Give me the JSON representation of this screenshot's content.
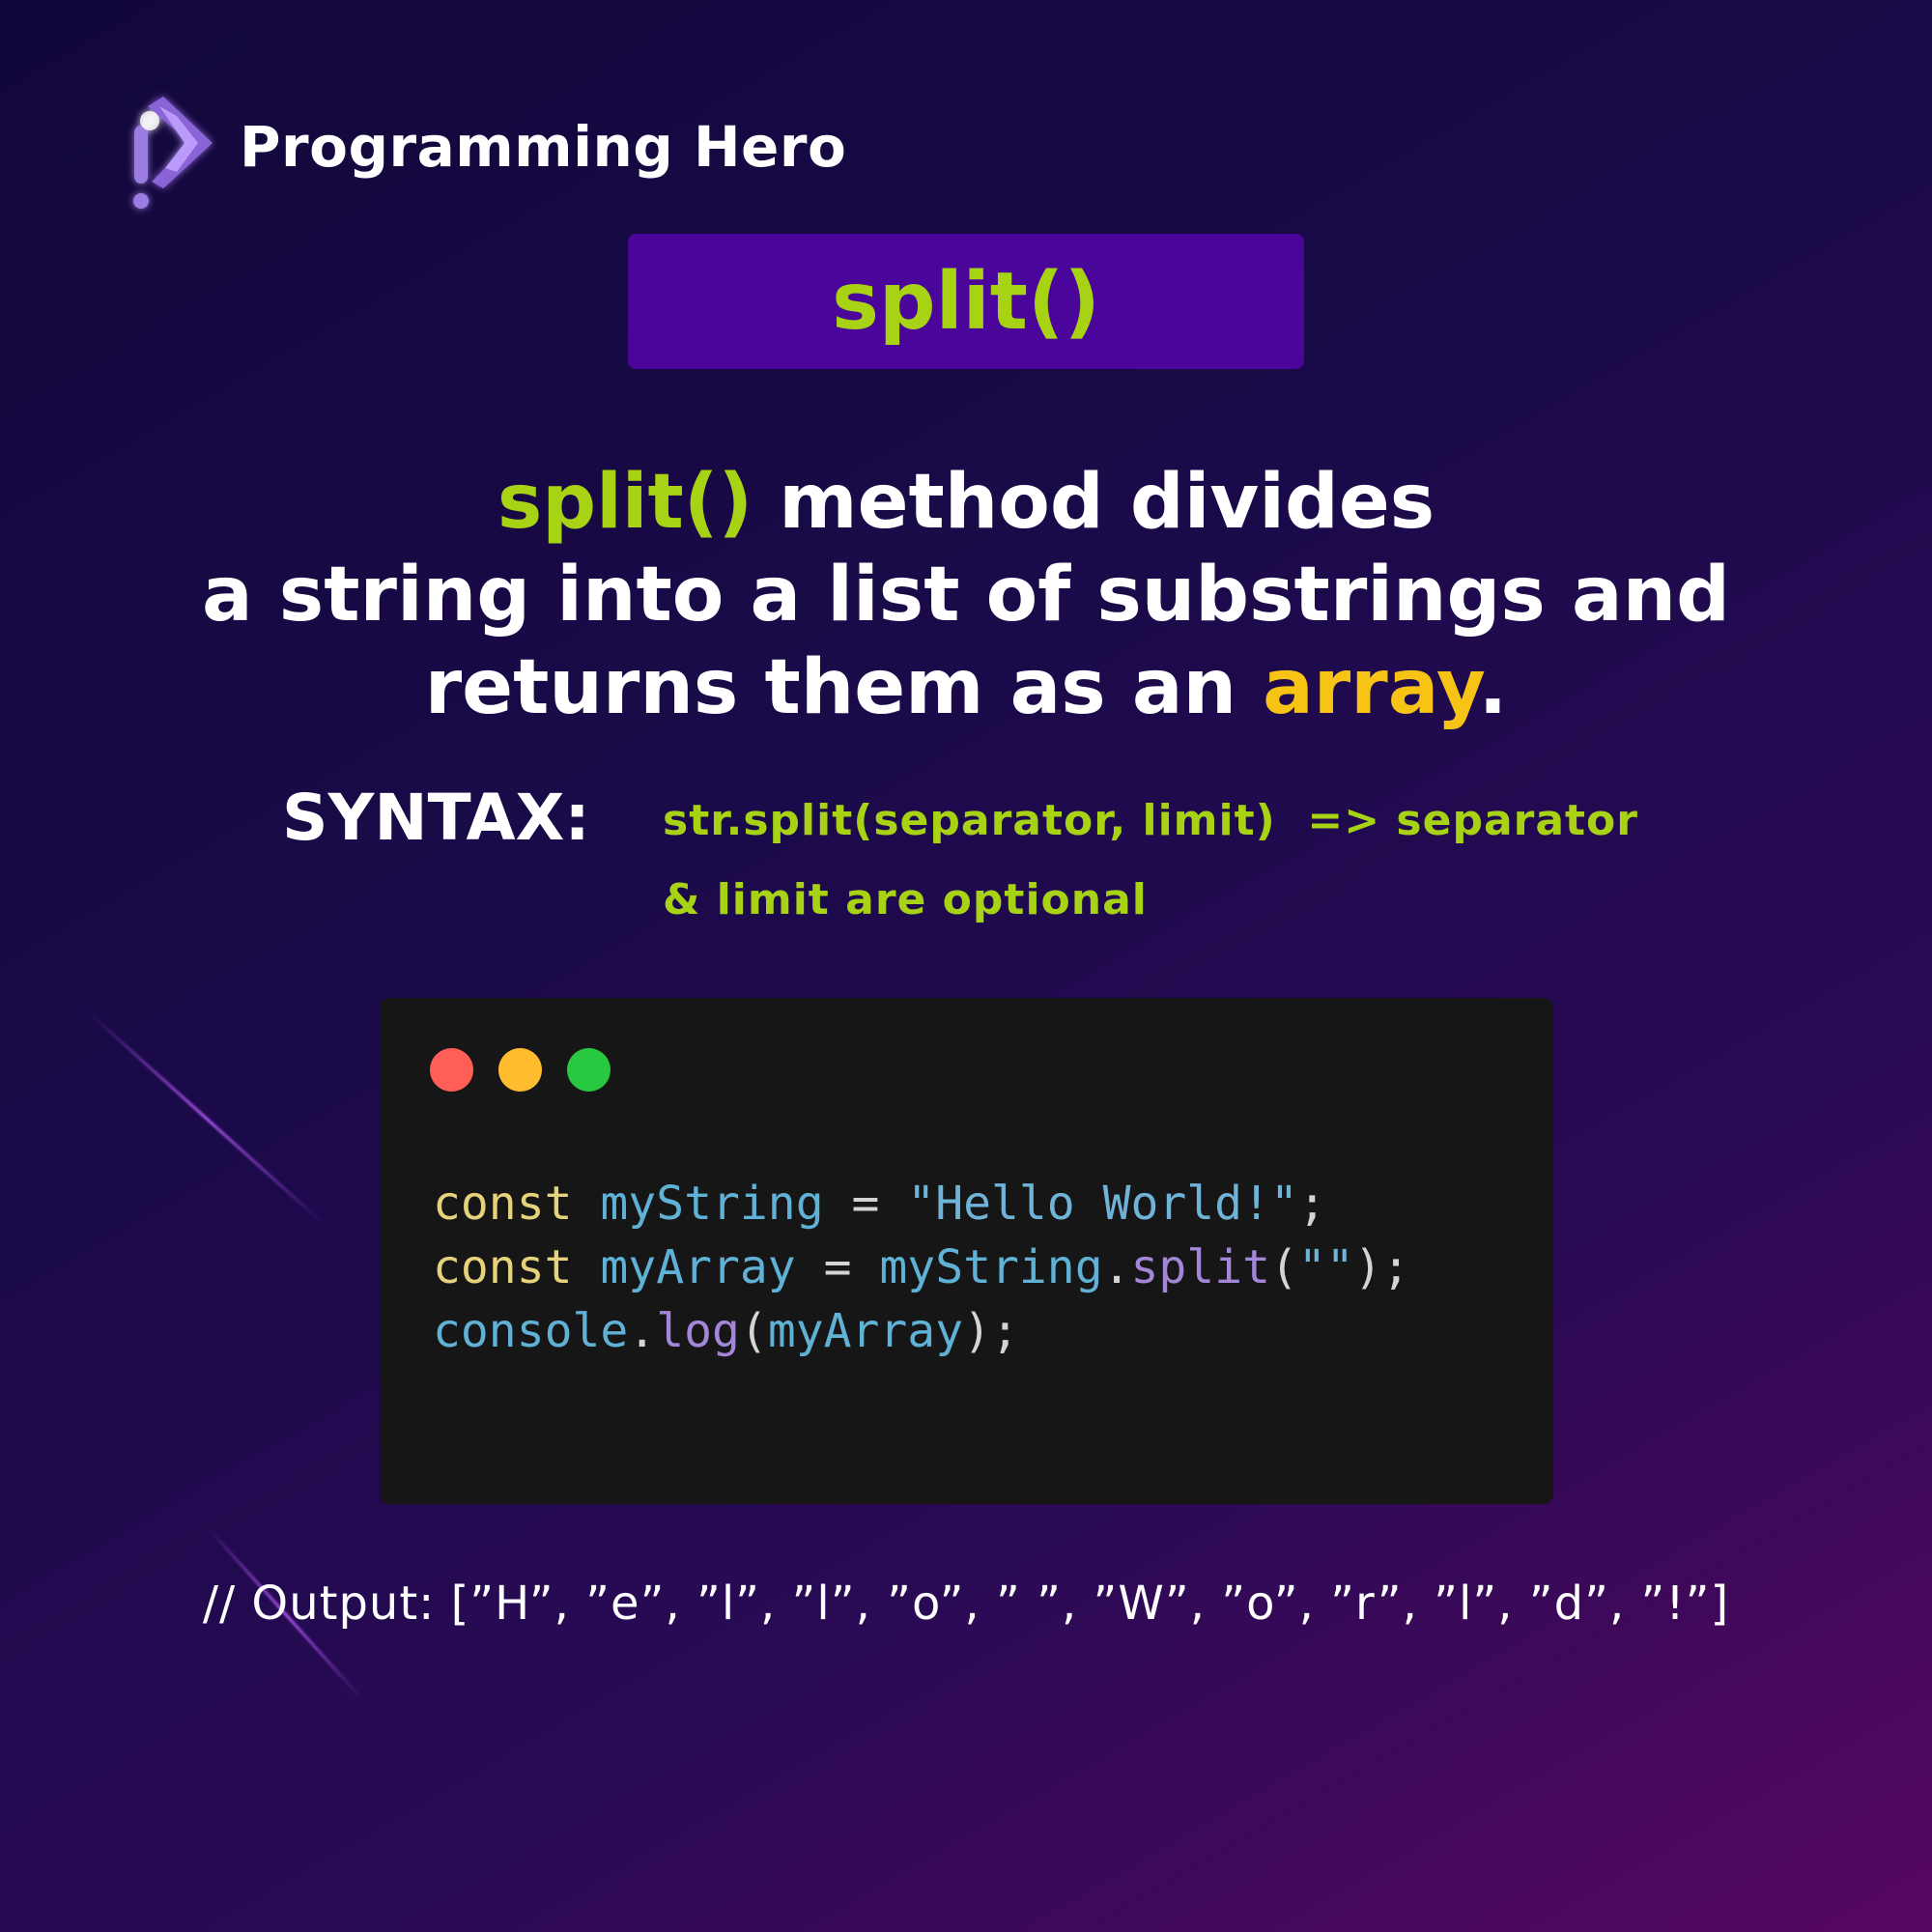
{
  "brand": {
    "name": "Programming Hero",
    "logo_icon": "programming-hero-logo-icon"
  },
  "title": "split()",
  "description": {
    "line1_method": "split()",
    "line1_rest": " method divides",
    "line2": "a string into a list of substrings and",
    "line3_pre": "returns them as an ",
    "line3_highlight": "array",
    "line3_post": "."
  },
  "syntax": {
    "label": "SYNTAX:",
    "line1": "str.split(separator, limit)  => separator",
    "line2": "& limit are optional"
  },
  "code_window": {
    "dots": [
      "#ff5f57",
      "#febc2e",
      "#28c840"
    ],
    "line1": {
      "kw": "const",
      "var": "myString",
      "eq": " = ",
      "str": "\"Hello World!\"",
      "end": ";"
    },
    "line2": {
      "kw": "const",
      "var": "myArray",
      "eq": " = ",
      "obj": "myString",
      "dot": ".",
      "fn": "split",
      "open": "(",
      "str": "\"\"",
      "close": ");"
    },
    "line3": {
      "obj": "console",
      "dot": ".",
      "fn": "log",
      "open": "(",
      "arg": "myArray",
      "close": ");"
    }
  },
  "output": "// Output: [”H”, ”e”, ”l”, ”l”, ”o”, ” ”, ”W”, ”o”, ”r”, ”l”, ”d”, ”!”]",
  "colors": {
    "accent_green": "#a8d214",
    "accent_yellow": "#f7c315",
    "title_box": "#4a059a"
  }
}
